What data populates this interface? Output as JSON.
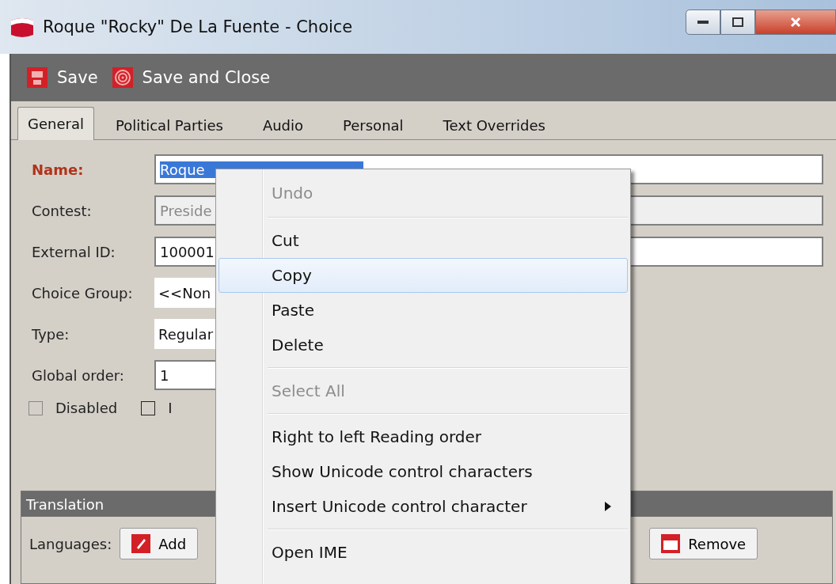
{
  "window": {
    "title": "Roque \"Rocky\" De La Fuente - Choice"
  },
  "toolbar": [
    {
      "label": "Save",
      "kind": "save"
    },
    {
      "label": "Save and Close",
      "kind": "close"
    }
  ],
  "tabs": [
    {
      "label": "General",
      "selected": true
    },
    {
      "label": "Political Parties",
      "selected": false
    },
    {
      "label": "Audio",
      "selected": false
    },
    {
      "label": "Personal",
      "selected": false
    },
    {
      "label": "Text Overrides",
      "selected": false
    }
  ],
  "fields": [
    {
      "label": "Name:",
      "value": "Roque",
      "kind": "text",
      "required": true,
      "disabled": false,
      "selected_text": true
    },
    {
      "label": "Contest:",
      "value": "Preside",
      "kind": "text",
      "required": false,
      "disabled": true,
      "selected_text": false
    },
    {
      "label": "External ID:",
      "value": "100001",
      "kind": "text",
      "required": false,
      "disabled": false,
      "selected_text": false
    },
    {
      "label": "Choice Group:",
      "value": "<<Non",
      "kind": "combo",
      "required": false,
      "disabled": false,
      "selected_text": false
    },
    {
      "label": "Type:",
      "value": "Regular",
      "kind": "combo",
      "required": false,
      "disabled": false,
      "selected_text": false
    },
    {
      "label": "Global order:",
      "value": "1",
      "kind": "short",
      "required": false,
      "disabled": false,
      "selected_text": false
    }
  ],
  "checkboxes": [
    {
      "label": "Disabled",
      "checked": false,
      "disabled": true
    },
    {
      "label": "I",
      "checked": false,
      "disabled": false
    }
  ],
  "translation": {
    "title": "Translation",
    "label": "Languages:",
    "buttons": [
      {
        "label": "Add",
        "kind": "add"
      },
      {
        "label": "Remove",
        "kind": "remove"
      }
    ]
  },
  "context_menu": [
    {
      "label": "Undo",
      "disabled": true,
      "highlighted": false,
      "submenu": false,
      "separator_after": true
    },
    {
      "label": "Cut",
      "disabled": false,
      "highlighted": false,
      "submenu": false,
      "separator_after": false
    },
    {
      "label": "Copy",
      "disabled": false,
      "highlighted": true,
      "submenu": false,
      "separator_after": false
    },
    {
      "label": "Paste",
      "disabled": false,
      "highlighted": false,
      "submenu": false,
      "separator_after": false
    },
    {
      "label": "Delete",
      "disabled": false,
      "highlighted": false,
      "submenu": false,
      "separator_after": true
    },
    {
      "label": "Select All",
      "disabled": true,
      "highlighted": false,
      "submenu": false,
      "separator_after": true
    },
    {
      "label": "Right to left Reading order",
      "disabled": false,
      "highlighted": false,
      "submenu": false,
      "separator_after": false
    },
    {
      "label": "Show Unicode control characters",
      "disabled": false,
      "highlighted": false,
      "submenu": false,
      "separator_after": false
    },
    {
      "label": "Insert Unicode control character",
      "disabled": false,
      "highlighted": false,
      "submenu": true,
      "separator_after": true
    },
    {
      "label": "Open IME",
      "disabled": false,
      "highlighted": false,
      "submenu": false,
      "separator_after": false
    }
  ]
}
